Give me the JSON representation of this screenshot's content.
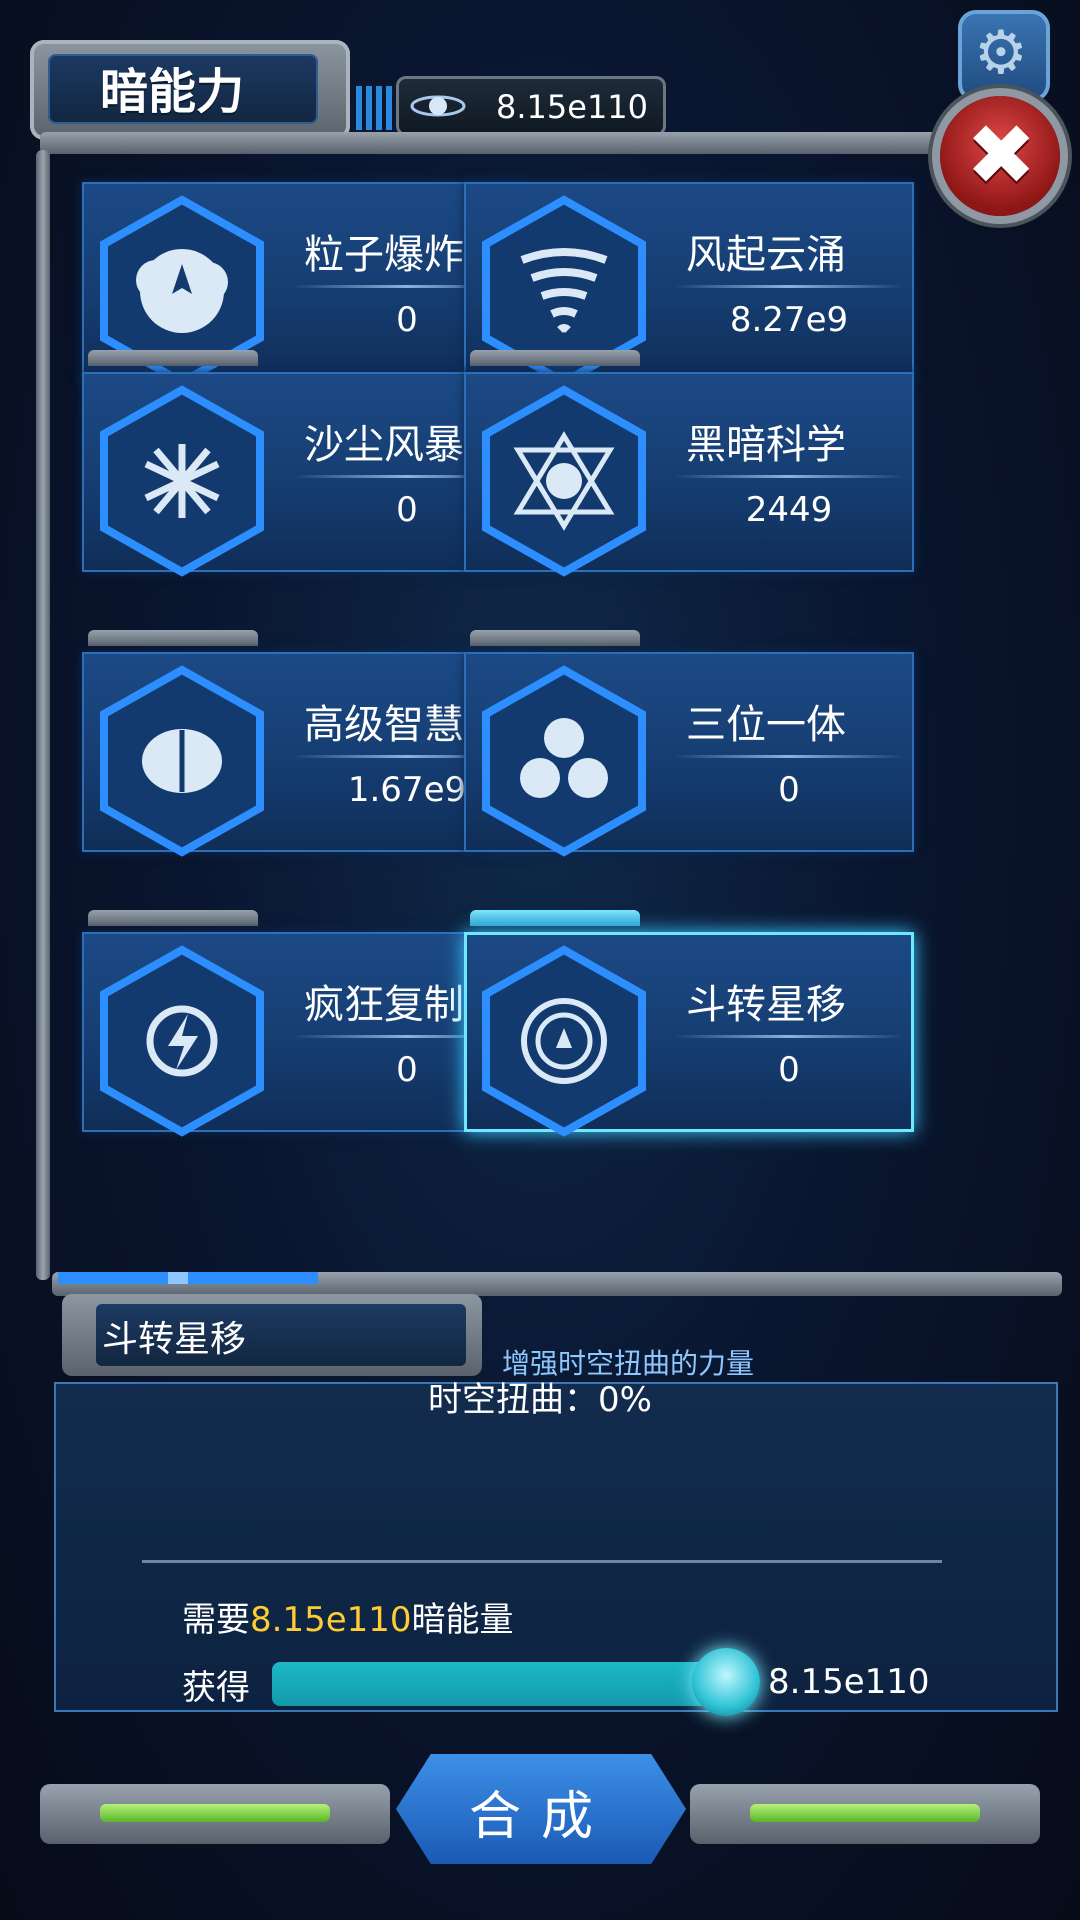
{
  "header": {
    "title": "暗能力",
    "energy_icon": "galaxy-icon",
    "energy_value": "8.15e110",
    "settings_icon": "gear-icon",
    "close_icon": "close-icon"
  },
  "abilities": [
    {
      "name": "粒子爆炸",
      "value": "0",
      "icon": "explosion-icon"
    },
    {
      "name": "风起云涌",
      "value": "8.27e9",
      "icon": "tornado-icon"
    },
    {
      "name": "沙尘风暴",
      "value": "0",
      "icon": "shatter-icon"
    },
    {
      "name": "黑暗科学",
      "value": "2449",
      "icon": "hexagram-icon"
    },
    {
      "name": "高级智慧",
      "value": "1.67e9",
      "icon": "brain-icon"
    },
    {
      "name": "三位一体",
      "value": "0",
      "icon": "trinity-icon"
    },
    {
      "name": "疯狂复制",
      "value": "0",
      "icon": "lightning-icon"
    },
    {
      "name": "斗转星移",
      "value": "0",
      "icon": "vortex-icon"
    }
  ],
  "detail": {
    "title": "斗转星移",
    "description": "增强时空扭曲的力量",
    "warp_label": "时空扭曲：0%",
    "need_prefix": "需要",
    "need_amount": "8.15e110",
    "need_suffix": "暗能量",
    "get_label": "获得",
    "get_value": "8.15e110",
    "slider_fill": 1.0
  },
  "footer": {
    "combine_label": "合成"
  },
  "colors": {
    "accent": "#1cb8c8",
    "highlight": "#ffcc33",
    "card": "#1c4a86",
    "close": "#d83a3a"
  }
}
